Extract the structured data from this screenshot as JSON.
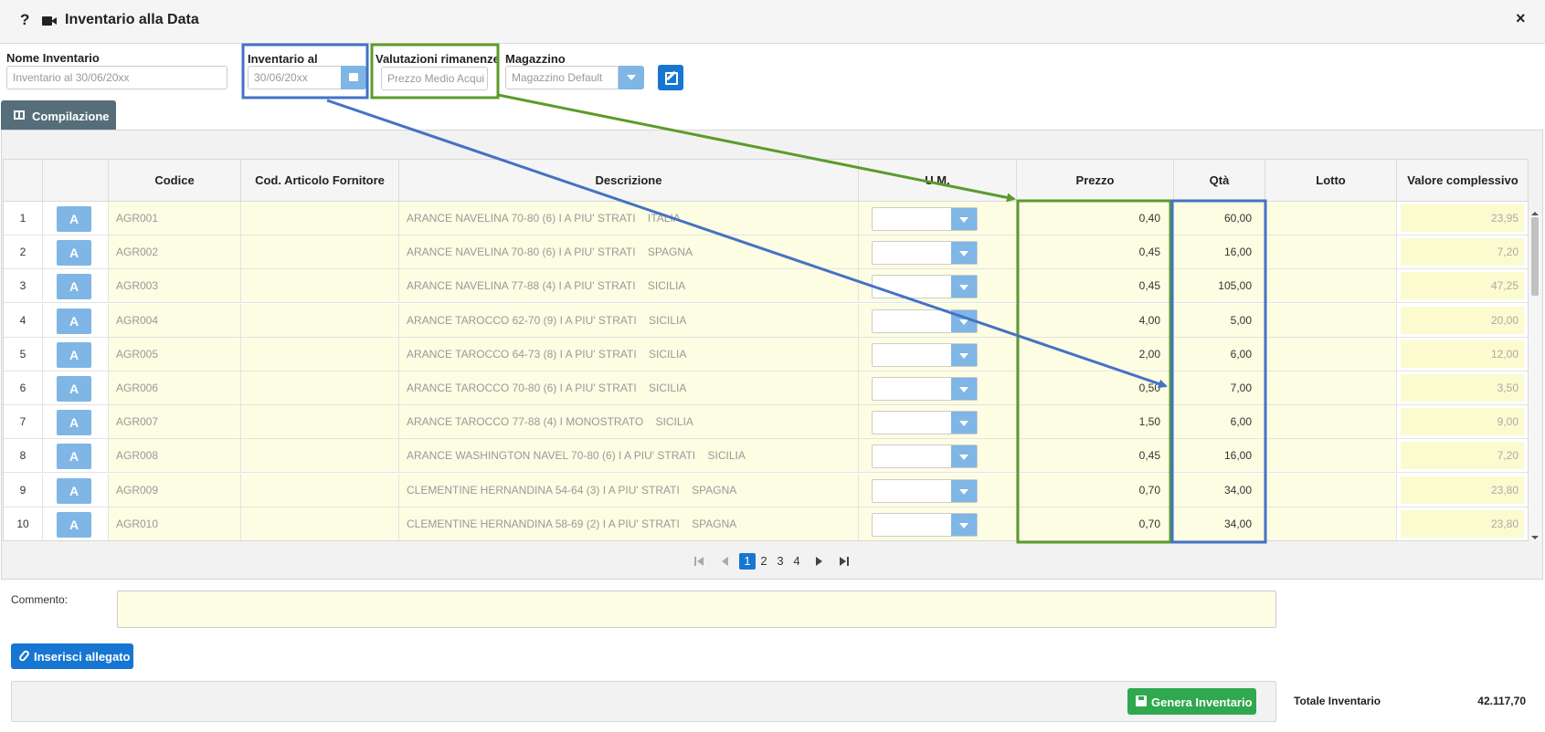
{
  "window": {
    "help_label": "?",
    "title": "Inventario alla Data",
    "close_label": "×"
  },
  "form": {
    "nome": {
      "label": "Nome Inventario",
      "value": "Inventario al 30/06/20xx"
    },
    "data": {
      "label": "Inventario al",
      "value": "30/06/20xx"
    },
    "valutazioni": {
      "label": "Valutazioni rimanenze",
      "value": "Prezzo Medio Acqui"
    },
    "magazzino": {
      "label": "Magazzino",
      "value": "Magazzino Default"
    }
  },
  "tab": {
    "label": "Compilazione"
  },
  "table": {
    "columns": [
      "Codice",
      "Cod. Articolo Fornitore",
      "Descrizione",
      "U.M.",
      "Prezzo",
      "Qtà",
      "Lotto",
      "Valore complessivo"
    ],
    "action_label": "A",
    "rows": [
      {
        "n": "1",
        "codice": "AGR001",
        "descrizione": "ARANCE NAVELINA 70-80 (6) I A PIU' STRATI    ITALIA",
        "prezzo": "0,40",
        "qta": "60,00",
        "valore": "23,95"
      },
      {
        "n": "2",
        "codice": "AGR002",
        "descrizione": "ARANCE NAVELINA 70-80 (6) I A PIU' STRATI    SPAGNA",
        "prezzo": "0,45",
        "qta": "16,00",
        "valore": "7,20"
      },
      {
        "n": "3",
        "codice": "AGR003",
        "descrizione": "ARANCE NAVELINA 77-88 (4) I A PIU' STRATI    SICILIA",
        "prezzo": "0,45",
        "qta": "105,00",
        "valore": "47,25"
      },
      {
        "n": "4",
        "codice": "AGR004",
        "descrizione": "ARANCE TAROCCO 62-70 (9) I A PIU' STRATI    SICILIA",
        "prezzo": "4,00",
        "qta": "5,00",
        "valore": "20,00"
      },
      {
        "n": "5",
        "codice": "AGR005",
        "descrizione": "ARANCE TAROCCO 64-73 (8) I A PIU' STRATI    SICILIA",
        "prezzo": "2,00",
        "qta": "6,00",
        "valore": "12,00"
      },
      {
        "n": "6",
        "codice": "AGR006",
        "descrizione": "ARANCE TAROCCO 70-80 (6) I A PIU' STRATI    SICILIA",
        "prezzo": "0,50",
        "qta": "7,00",
        "valore": "3,50"
      },
      {
        "n": "7",
        "codice": "AGR007",
        "descrizione": "ARANCE TAROCCO 77-88 (4) I MONOSTRATO    SICILIA",
        "prezzo": "1,50",
        "qta": "6,00",
        "valore": "9,00"
      },
      {
        "n": "8",
        "codice": "AGR008",
        "descrizione": "ARANCE WASHINGTON NAVEL 70-80 (6) I A PIU' STRATI    SICILIA",
        "prezzo": "0,45",
        "qta": "16,00",
        "valore": "7,20"
      },
      {
        "n": "9",
        "codice": "AGR009",
        "descrizione": "CLEMENTINE HERNANDINA 54-64 (3) I A PIU' STRATI    SPAGNA",
        "prezzo": "0,70",
        "qta": "34,00",
        "valore": "23,80"
      },
      {
        "n": "10",
        "codice": "AGR010",
        "descrizione": "CLEMENTINE HERNANDINA 58-69 (2) I A PIU' STRATI    SPAGNA",
        "prezzo": "0,70",
        "qta": "34,00",
        "valore": "23,80"
      }
    ]
  },
  "pagination": {
    "pages": [
      "1",
      "2",
      "3",
      "4"
    ],
    "current": "1",
    "icons": [
      "first-page-icon",
      "prev-page-icon",
      "next-page-icon",
      "last-page-icon"
    ]
  },
  "commento": {
    "label": "Commento:"
  },
  "buttons": {
    "attach": "Inserisci allegato",
    "generate": "Genera Inventario"
  },
  "totale": {
    "label": "Totale Inventario",
    "value": "42.117,70"
  },
  "colors": {
    "accent_blue": "#1676d2",
    "light_blue": "#7fb6e6",
    "green": "#2fa84f",
    "annot_blue": "#4472c4",
    "annot_green": "#5b9b2b",
    "row_yellow": "#fdfde3"
  }
}
